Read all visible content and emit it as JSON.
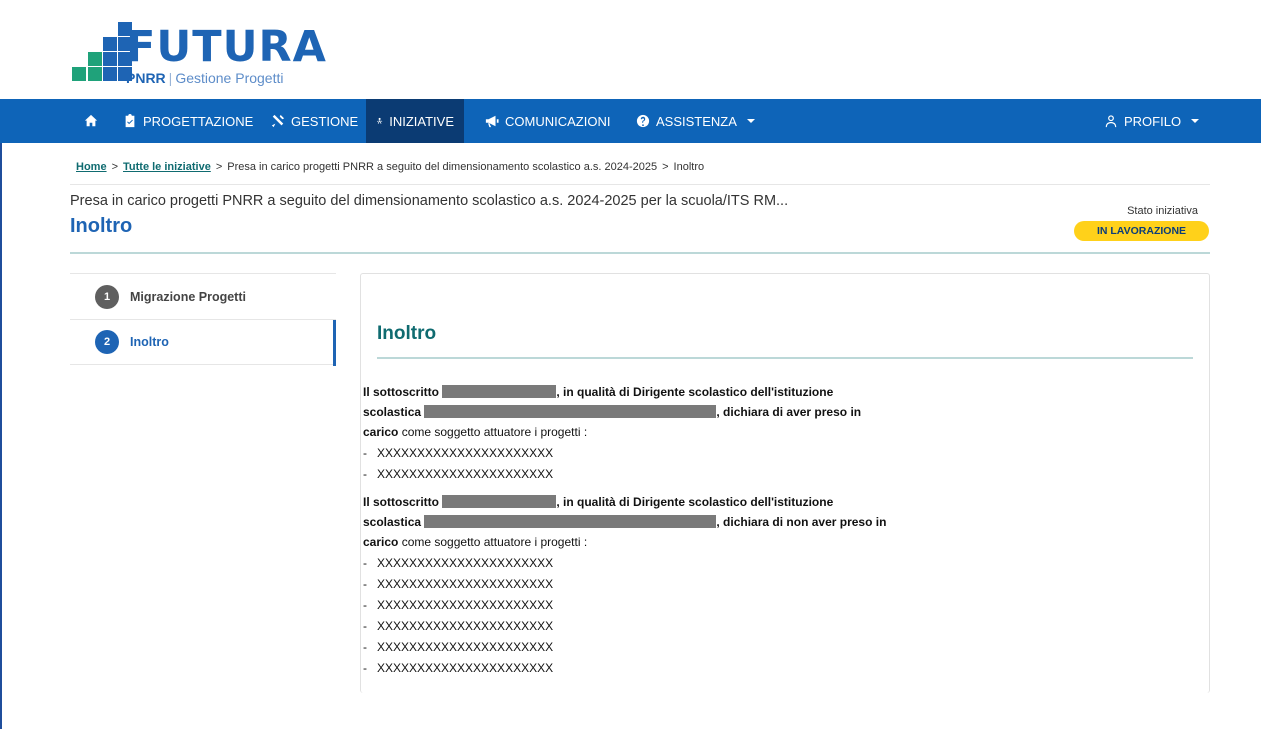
{
  "logo": {
    "word": "FUTURA",
    "sub_bold": "PNRR",
    "sub_rest": "Gestione Progetti"
  },
  "navbar": {
    "home_icon": "home-icon",
    "items": [
      {
        "label": "PROGETTAZIONE",
        "icon": "clipboard-icon"
      },
      {
        "label": "GESTIONE",
        "icon": "tools-icon"
      },
      {
        "label": "INIZIATIVE",
        "icon": "people-icon"
      },
      {
        "label": "COMUNICAZIONI",
        "icon": "megaphone-icon"
      },
      {
        "label": "ASSISTENZA",
        "icon": "question-icon"
      }
    ],
    "profile_label": "PROFILO",
    "profile_icon": "user-icon",
    "active_color": "#0b3b73",
    "bar_color": "#0e64b8"
  },
  "breadcrumb": {
    "home": "Home",
    "initiatives": "Tutte le iniziative",
    "separator": ">",
    "current_initiative": "Presa in carico progetti PNRR a seguito del dimensionamento scolastico a.s. 2024-2025",
    "current_page": "Inoltro"
  },
  "header": {
    "initiative_title": "Presa in carico progetti PNRR a seguito del dimensionamento scolastico a.s. 2024-2025 per la scuola/ITS RM...",
    "page_title": "Inoltro",
    "status_label": "Stato iniziativa",
    "status_value": "IN LAVORAZIONE"
  },
  "steps": [
    {
      "number": "1",
      "label": "Migrazione Progetti"
    },
    {
      "number": "2",
      "label": "Inoltro"
    }
  ],
  "card": {
    "title": "Inoltro",
    "declaration_1": {
      "prefix": "Il sottoscritto",
      "role": ", in qualità di Dirigente scolastico dell'istituzione",
      "school_prefix": "scolastica",
      "statement": ", dichiara di aver preso in",
      "carico": "carico",
      "carico_rest": "come soggetto attuatore i progetti :",
      "projects": [
        "XXXXXXXXXXXXXXXXXXXXXX",
        "XXXXXXXXXXXXXXXXXXXXXX"
      ]
    },
    "declaration_2": {
      "prefix": "Il sottoscritto",
      "role": ", in qualità di Dirigente scolastico dell'istituzione",
      "school_prefix": "scolastica",
      "statement": ", dichiara di non aver preso in",
      "carico": "carico",
      "carico_rest": "come soggetto attuatore i progetti :",
      "projects": [
        "XXXXXXXXXXXXXXXXXXXXXX",
        "XXXXXXXXXXXXXXXXXXXXXX",
        "XXXXXXXXXXXXXXXXXXXXXX",
        "XXXXXXXXXXXXXXXXXXXXXX",
        "XXXXXXXXXXXXXXXXXXXXXX",
        "XXXXXXXXXXXXXXXXXXXXXX"
      ]
    },
    "dash": "-"
  }
}
